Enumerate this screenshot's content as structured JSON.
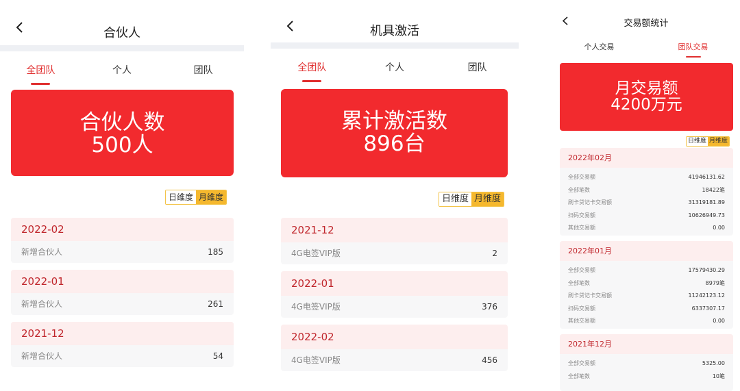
{
  "panel1": {
    "title": "合伙人",
    "tabs": [
      "全团队",
      "个人",
      "团队"
    ],
    "banner": {
      "line1": "合伙人数",
      "line2": "500人"
    },
    "toggle": [
      "日维度",
      "月维度"
    ],
    "cards": [
      {
        "period": "2022-02",
        "label": "新增合伙人",
        "value": "185"
      },
      {
        "period": "2022-01",
        "label": "新增合伙人",
        "value": "261"
      },
      {
        "period": "2021-12",
        "label": "新增合伙人",
        "value": "54"
      }
    ]
  },
  "panel2": {
    "title": "机具激活",
    "tabs": [
      "全团队",
      "个人",
      "团队"
    ],
    "banner": {
      "line1": "累计激活数",
      "line2": "896台"
    },
    "toggle": [
      "日维度",
      "月维度"
    ],
    "cards": [
      {
        "period": "2021-12",
        "label": "4G电签VIP版",
        "value": "2"
      },
      {
        "period": "2022-01",
        "label": "4G电签VIP版",
        "value": "376"
      },
      {
        "period": "2022-02",
        "label": "4G电签VIP版",
        "value": "456"
      }
    ]
  },
  "panel3": {
    "title": "交易额统计",
    "tabs": [
      "个人交易",
      "团队交易"
    ],
    "banner": {
      "line1": "月交易额",
      "line2": "4200万元"
    },
    "toggle": [
      "日维度",
      "月维度"
    ],
    "cards": [
      {
        "period": "2022年02月",
        "rows": [
          {
            "label": "全部交易额",
            "value": "41946131.62"
          },
          {
            "label": "全部笔数",
            "value": "18422笔"
          },
          {
            "label": "刷卡贷记卡交易额",
            "value": "31319181.89"
          },
          {
            "label": "扫码交易额",
            "value": "10626949.73"
          },
          {
            "label": "其他交易额",
            "value": "0.00"
          }
        ]
      },
      {
        "period": "2022年01月",
        "rows": [
          {
            "label": "全部交易额",
            "value": "17579430.29"
          },
          {
            "label": "全部笔数",
            "value": "8979笔"
          },
          {
            "label": "刷卡贷记卡交易额",
            "value": "11242123.12"
          },
          {
            "label": "扫码交易额",
            "value": "6337307.17"
          },
          {
            "label": "其他交易额",
            "value": "0.00"
          }
        ]
      },
      {
        "period": "2021年12月",
        "rows": [
          {
            "label": "全部交易额",
            "value": "5325.00"
          },
          {
            "label": "全部笔数",
            "value": "10笔"
          }
        ]
      }
    ]
  },
  "colors": {
    "accent": "#e02e2e",
    "banner": "#f22a2e",
    "toggle_active": "#f5b82e",
    "card_header": "#fdeeee",
    "card_body": "#f7f7f8"
  },
  "icons": {
    "back": "chevron-left-icon"
  }
}
